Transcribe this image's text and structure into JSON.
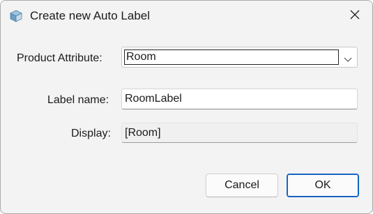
{
  "window": {
    "title": "Create new Auto Label",
    "icon": "3d-box-icon",
    "close_icon": "close-icon"
  },
  "form": {
    "product_attribute": {
      "label": "Product Attribute:",
      "value": "Room"
    },
    "label_name": {
      "label": "Label name:",
      "value": "RoomLabel"
    },
    "display": {
      "label": "Display:",
      "value": "[Room]"
    }
  },
  "buttons": {
    "cancel": "Cancel",
    "ok": "OK"
  },
  "colors": {
    "background": "#f3f3f3",
    "accent": "#1565c0",
    "input_bg": "#ffffff",
    "readonly_bg": "#f0f0f0"
  }
}
